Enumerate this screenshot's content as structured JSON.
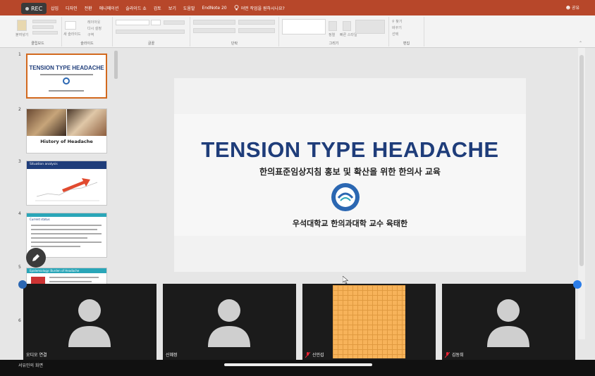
{
  "recording": {
    "label": "REC"
  },
  "menu": {
    "tabs": [
      "삽입",
      "디자인",
      "전환",
      "애니메이션",
      "슬라이드 쇼",
      "검토",
      "보기",
      "도움말",
      "EndNote 20"
    ],
    "tell_me": "어떤 작업을 원하시나요?",
    "share": "공유"
  },
  "ribbon": {
    "groups": [
      "클립보드",
      "슬라이드",
      "글꼴",
      "단락",
      "그리기",
      "편집"
    ],
    "paste": "붙여넣기",
    "new_slide": "새 슬라이드",
    "layout": "레이아웃",
    "reset": "다시 설정",
    "section": "구역",
    "arrange": "정렬",
    "quick_styles": "빠른 스타일",
    "find": "찾기",
    "replace": "바꾸기",
    "select": "선택"
  },
  "thumbnails": [
    {
      "num": "1",
      "title": "TENSION TYPE HEADACHE"
    },
    {
      "num": "2",
      "title": "History of Headache"
    },
    {
      "num": "3",
      "title": "Situation analysis"
    },
    {
      "num": "4",
      "title": "Current status"
    },
    {
      "num": "5",
      "title": "Epidemiology: Burden of Headache"
    },
    {
      "num": "6",
      "title": ""
    }
  ],
  "slide": {
    "title": "TENSION TYPE HEADACHE",
    "subtitle": "한의표준임상지침 홍보 및 확산을 위한 한의사 교육",
    "author": "우석대학교 한의과대학 교수 육태한"
  },
  "participants": [
    {
      "name": "오디오 연결",
      "muted": false
    },
    {
      "name": "신혜정",
      "muted": false
    },
    {
      "name": "신민섭",
      "muted": true
    },
    {
      "name": "김동희",
      "muted": true
    }
  ],
  "footer": {
    "active_speaker": "서유민의 화면"
  },
  "colors": {
    "accent": "#b7472a",
    "title_blue": "#1f3d7a",
    "selected_border": "#d2691e"
  }
}
